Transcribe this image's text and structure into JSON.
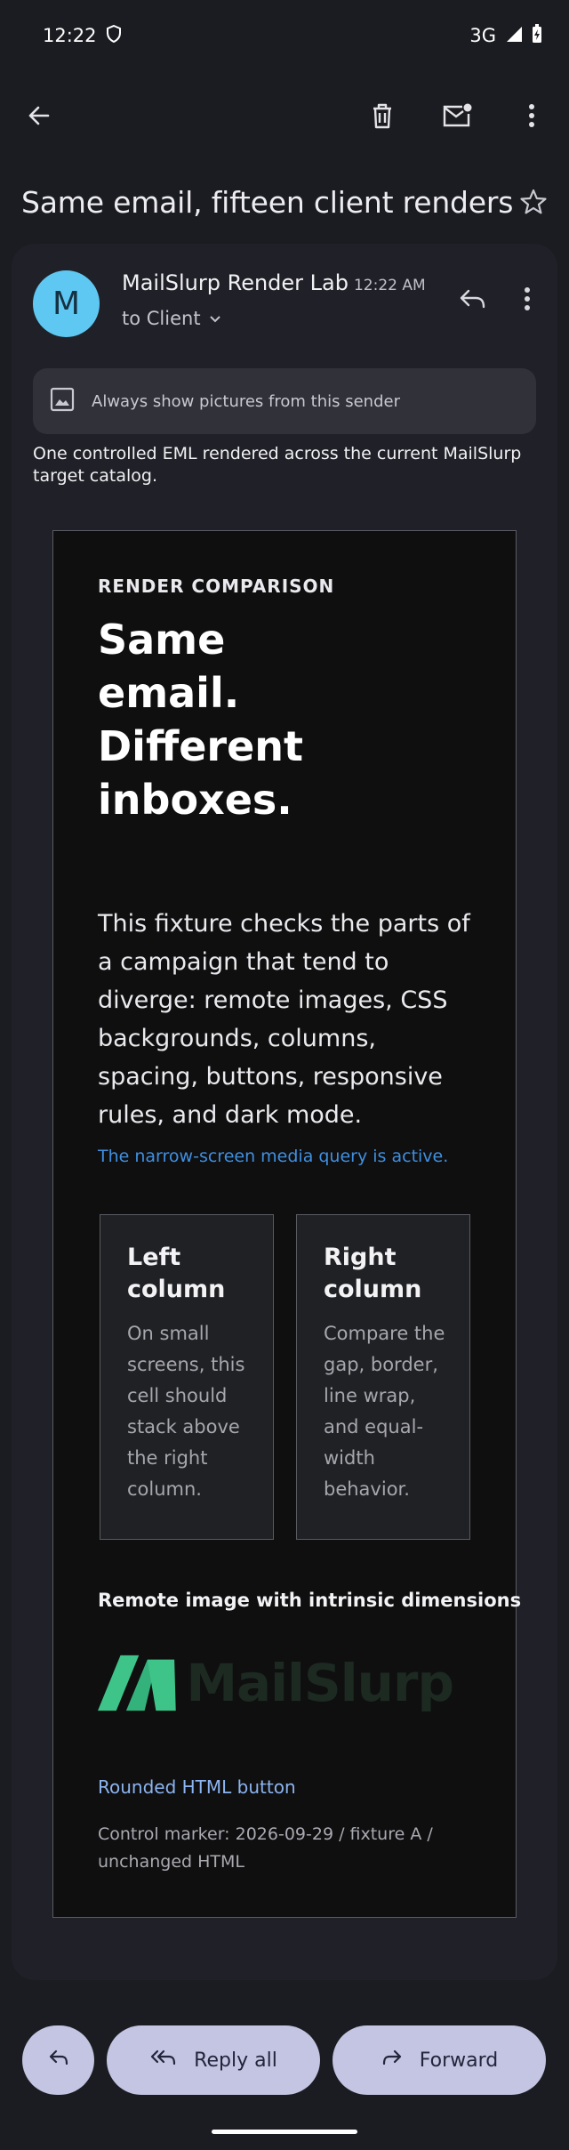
{
  "status_bar": {
    "time": "12:22",
    "network": "3G"
  },
  "subject": "Same email, fifteen client renders",
  "message": {
    "avatar_letter": "M",
    "sender_name": "MailSlurp Render Lab",
    "time": "12:22 AM",
    "recipient": "to Client",
    "images_banner": "Always show pictures from this sender",
    "preview": "One controlled EML rendered across the current MailSlurp target catalog."
  },
  "email_body": {
    "eyebrow": "RENDER COMPARISON",
    "headline": "Same email. Different inboxes.",
    "intro": "This fixture checks the parts of a campaign that tend to diverge: remote images, CSS backgrounds, columns, spacing, buttons, responsive rules, and dark mode.",
    "media_note": "The narrow-screen media query is active.",
    "left_column": {
      "title": "Left column",
      "text": "On small screens, this cell should stack above the right column."
    },
    "right_column": {
      "title": "Right column",
      "text": "Compare the gap, border, line wrap, and equal-width behavior."
    },
    "image_heading": "Remote image with intrinsic dimensions",
    "logo_text": "MailSlurp",
    "cta": "Rounded HTML button",
    "control_marker": "Control marker: 2026-09-29 / fixture A / unchanged HTML"
  },
  "actions": {
    "reply_all": "Reply all",
    "forward": "Forward"
  },
  "colors": {
    "background": "#1b1c21",
    "card": "#202128",
    "avatar": "#5ec8f2",
    "action_pill": "#c3c5e2",
    "link_blue": "#3f8fe0",
    "logo_green": "#3ec489"
  },
  "icons": [
    "back-arrow-icon",
    "trash-icon",
    "mark-unread-icon",
    "more-vert-icon",
    "star-icon",
    "reply-icon",
    "chevron-down-icon",
    "image-icon",
    "reply-all-icon",
    "forward-icon"
  ]
}
